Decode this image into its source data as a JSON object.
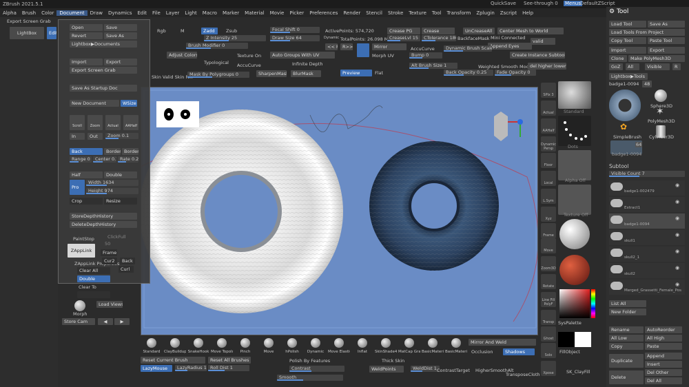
{
  "window": {
    "title": "ZBrush 2021.5.1",
    "quicksave": "QuickSave",
    "seethrough": "See-through 0",
    "menus": "Menus",
    "defaultscript": "DefaultZScript"
  },
  "menu": [
    "Alpha",
    "Brush",
    "Color",
    "Document",
    "Draw",
    "Dynamics",
    "Edit",
    "File",
    "Layer",
    "Light",
    "Macro",
    "Marker",
    "Material",
    "Movie",
    "Picker",
    "Preferences",
    "Render",
    "Stencil",
    "Stroke",
    "Texture",
    "Tool",
    "Transform",
    "Zplugin",
    "Zscript",
    "Help"
  ],
  "menu_active": "Document",
  "left": {
    "export_grab": "Export Screen Grab",
    "lightbox": "LightBox",
    "edit": "Edit"
  },
  "document_menu": {
    "open": "Open",
    "save": "Save",
    "revert": "Revert",
    "save_as": "Save As",
    "lightbox_docs": "Lightbox▶Documents",
    "import": "Import",
    "export": "Export",
    "export_grab": "Export Screen Grab",
    "save_startup": "Save As Startup Doc",
    "new_doc": "New Document",
    "wsize": "WSize",
    "scroll": "Scroll",
    "zoom": "Zoom",
    "actual": "Actual",
    "aahalf": "AAHalf",
    "in": "In",
    "out": "Out",
    "zoom_val": "Zoom 0.1",
    "back": "Back",
    "border": "Border",
    "border2": "Border2",
    "range": "Range 0",
    "center": "Center 0.7",
    "rate": "Rate 0.25",
    "half": "Half",
    "double": "Double",
    "pro": "Pro",
    "width": "Width 1634",
    "height": "Height 974",
    "crop": "Crop",
    "resize": "Resize",
    "store_depth": "StoreDepthHistory",
    "delete_depth": "DeleteDepthHistory"
  },
  "lower_left": {
    "paintstop": "PaintStop",
    "clickfull": "ClickFull",
    "zapplink": "ZAppLink",
    "item50": "50",
    "zapplink_props": "ZAppLink Properties",
    "frame": "Frame",
    "clear_all": "Clear All",
    "back": "Back",
    "cur2": "Cur2",
    "curl": "Curl",
    "double": "Double",
    "clear_to": "Clear To",
    "morph": "Morph",
    "load_views": "Load Views",
    "store_cam": "Store Cam"
  },
  "top": {
    "rgb": "Rgb",
    "m": "M",
    "zadd": "Zadd",
    "zsub": "Zsub",
    "focal": "Focal Shift 0",
    "zintensity": "Z Intensity 25",
    "draw_size": "Draw Size 64",
    "dynamic": "Dynamic",
    "active_points": "ActivePoints: 574,720",
    "total_points": "TotalPoints: 26.098 Mil",
    "create_pg": "Crease PG",
    "crease": "Crease",
    "uncrease_all": "UnCreaseAll",
    "center_mesh": "Center Mesh to World",
    "crease_lvl": "CreaseLvl 15",
    "ctolerance": "CTolerance 180",
    "backface": "BackfaceMask",
    "mini": "Mini Connected",
    "valid": "valid",
    "append_eyes": "Append Eyes",
    "brush_modifier": "Brush Modifier 0",
    "lr": "<< R",
    "rr": "R>>",
    "adjust": "Adjust Colors",
    "texture_on": "Texture On",
    "auto_groups": "Auto Groups With UV",
    "mirror": "Mirror",
    "accucurve": "AccuCurve",
    "bump": "Bump 0",
    "dynamic_brush": "Dynamic Brush Scale 0",
    "create_instance": "Create Instance Subtool",
    "morph_uv": "Morph UV",
    "skin": "Skin Valid Skin R...",
    "typological": "Typological",
    "accucurve2": "AccuCurve",
    "infinite": "Infinite Depth",
    "alt_brush": "Alt Brush Size 1",
    "weighted": "Weighted Smooth Mode",
    "del_higher": "del higher lower v",
    "mask_poly": "Mask By Polygroups 0",
    "sharpen": "SharpenMask",
    "blur": "BlurMask",
    "preview": "Preview",
    "flat": "Flat",
    "back_opacity": "Back Opacity 0.25",
    "fade": "Fade Opacity 0",
    "delete_upper": "Delete Upper",
    "clear": "Clear"
  },
  "sidebar": [
    {
      "name": "spix",
      "label": "SPix 3"
    },
    {
      "name": "actual",
      "label": "Actual"
    },
    {
      "name": "aahalf",
      "label": "AAHalf"
    },
    {
      "name": "dynamic",
      "label": "Dynamic Persp"
    },
    {
      "name": "floor",
      "label": "Floor"
    },
    {
      "name": "local",
      "label": "Local"
    },
    {
      "name": "lsym",
      "label": "L.Sym"
    },
    {
      "name": "xyz",
      "label": "Xyz"
    },
    {
      "name": "frame",
      "label": "Frame"
    },
    {
      "name": "move",
      "label": "Move"
    },
    {
      "name": "zoom3d",
      "label": "Zoom3D"
    },
    {
      "name": "rotate",
      "label": "Rotate"
    },
    {
      "name": "linefill",
      "label": "Line Fill PolyF"
    },
    {
      "name": "transp",
      "label": "Transp"
    },
    {
      "name": "ghost",
      "label": "Ghost"
    },
    {
      "name": "solo",
      "label": "Solo"
    },
    {
      "name": "xpose",
      "label": "Xpose"
    }
  ],
  "material_panel": {
    "standard": "Standard",
    "dots": "Dots",
    "alpha_off": "Alpha Off",
    "texture_off": "Texture Off",
    "matcap": "MatCap Red Wax",
    "syspalette": "SysPalette",
    "fillobject": "FillObject"
  },
  "brushes": [
    {
      "label": "Standard"
    },
    {
      "label": "ClayBuildup"
    },
    {
      "label": "SnakeHook"
    },
    {
      "label": "Move Topologic"
    },
    {
      "label": "Pinch"
    },
    {
      "label": "Move"
    },
    {
      "label": "hPolish"
    },
    {
      "label": "Dynamic"
    },
    {
      "label": "Move Elastic"
    },
    {
      "label": "Inflat"
    },
    {
      "label": "SkinShade4"
    },
    {
      "label": "MatCap Gray"
    },
    {
      "label": "BasicMaterial2"
    },
    {
      "label": "BasicMaterial"
    }
  ],
  "bottom": {
    "reset_current": "Reset Current Brush",
    "reset_all": "Reset All Brushes",
    "lazymouse": "LazyMouse",
    "lazyradius": "LazyRadius 1",
    "roll": "Roll Dist 1",
    "polish_feat": "Polish By Features",
    "contrast": "Contrast",
    "smooth": "Smooth",
    "thick": "Thick Skin",
    "weldpoints": "WeldPoints",
    "welddist": "WeldDist 1",
    "mirror_weld": "Mirror And Weld",
    "occlusion": "Occlusion",
    "shadows": "Shadows",
    "contrast_targ": "ContrastTarget",
    "higher_smooth": "HigherSmoothAlt",
    "transpose_cloth": "TransposeCloth",
    "sk_clayfill": "SK_ClayFill",
    "solo": "Solo",
    "fill": "Fill",
    "xpose": "Xpose"
  },
  "tool": {
    "header": "Tool",
    "load_tool": "Load Tool",
    "save_as": "Save As",
    "load_project": "Load Tools From Project",
    "copy_tool": "Copy Tool",
    "paste": "Paste Tool",
    "import": "Import",
    "export": "Export",
    "clone": "Clone",
    "make_polymesh": "Make PolyMesh3D",
    "goz": "GoZ",
    "all": "All",
    "visible": "Visible",
    "r": "R",
    "lightbox_tools": "Lightbox▶Tools",
    "current": "badge1-0094_48",
    "current_val": "48",
    "sphere": "Sphere3D",
    "polymesh": "PolyMesh3D",
    "simplebrush": "SimpleBrush",
    "cylinder": "Cylinder3D",
    "count": "64",
    "badge": "badge1-0094",
    "subtool": "Subtool",
    "visible_count": "Visible Count 7",
    "subtools": [
      "badge1-002479",
      "Extract1",
      "badge1-0094",
      "skull1",
      "skull2_1",
      "skull2",
      "Merged_Grassetti_Female_Pos"
    ],
    "list_all": "List All",
    "new_folder": "New Folder",
    "rename": "Rename",
    "autoreorder": "AutoReorder",
    "all_low": "All Low",
    "all_high": "All High",
    "copy": "Copy",
    "paste2": "Paste",
    "duplicate": "Duplicate",
    "append": "Append",
    "insert": "Insert",
    "delete": "Delete",
    "del_other": "Del Other",
    "del_all": "Del All"
  },
  "overlay": {
    "eyes_label": "Oo",
    "signature": "Vahid"
  },
  "colors": {
    "canvas": "#6a8cc5",
    "accent": "#3c6eb4",
    "panel": "#2f2f2f"
  }
}
